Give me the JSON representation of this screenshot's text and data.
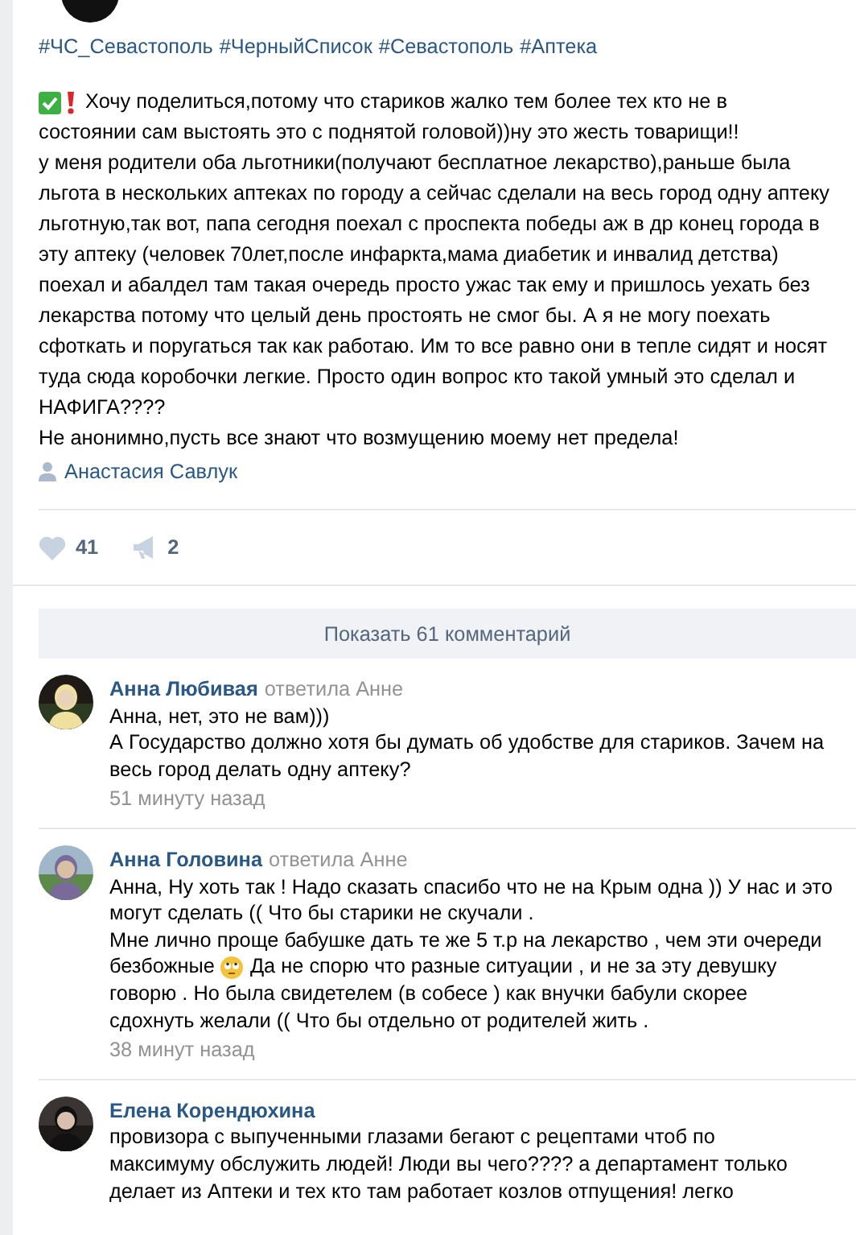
{
  "post": {
    "hashtags": [
      "#ЧС_Севастополь",
      "#ЧерныйСписок",
      "#Севастополь",
      "#Аптека"
    ],
    "lines": [
      "Хочу поделиться,потому что стариков жалко тем более тех кто не в",
      "состоянии сам выстоять это с поднятой головой))ну это жесть товарищи!!",
      "у меня родители оба льготники(получают бесплатное лекарство),раньше была",
      "льгота в нескольких аптеках по городу а сейчас сделали на весь город одну аптеку",
      "льготную,так вот, папа сегодня поехал с проспекта победы аж в др конец города в",
      "эту аптеку (человек 70лет,после инфаркта,мама диабетик и инвалид детства)",
      "поехал и абалдел там такая очередь просто ужас так ему и пришлось уехать без",
      "лекарства потому что целый день простоять не смог бы. А я не могу поехать",
      "сфоткать и поругаться так как работаю. Им то все равно они в тепле сидят и носят",
      "туда сюда коробочки легкие. Просто один вопрос кто такой умный это сделал и",
      "НАФИГА????",
      "Не анонимно,пусть все знают что возмущению моему нет предела!"
    ],
    "author": "Анастасия Савлук",
    "likes": "41",
    "reposts": "2"
  },
  "show_comments": "Показать 61 комментарий",
  "comments": [
    {
      "name": "Анна Любивая",
      "reply_to": "ответила Анне",
      "lines": [
        {
          "kind": "text",
          "text": "Анна, нет, это не вам)))"
        },
        {
          "kind": "text",
          "text": "А Государство должно хотя бы думать об удобстве для стариков. Зачем на"
        },
        {
          "kind": "text",
          "text": "весь город делать одну аптеку?"
        }
      ],
      "time": "51 минуту назад"
    },
    {
      "name": "Анна Головина",
      "reply_to": "ответила Анне",
      "lines": [
        {
          "kind": "text",
          "text": "Анна, Ну хоть так ! Надо сказать спасибо что не на Крым одна )) У нас и это"
        },
        {
          "kind": "text",
          "text": "могут сделать (( Что бы старики не скучали ."
        },
        {
          "kind": "text",
          "text": "Мне лично проще бабушке дать те же 5 т.р на лекарство , чем эти очереди"
        },
        {
          "kind": "emoji",
          "before": "безбожные",
          "after": "Да не спорю что разные ситуации , и не за эту девушку"
        },
        {
          "kind": "text",
          "text": "говорю . Но была свидетелем (в собесе ) как внучки бабули скорее"
        },
        {
          "kind": "text",
          "text": "сдохнуть желали (( Что бы отдельно от родителей жить ."
        }
      ],
      "time": "38 минут назад"
    },
    {
      "name": "Елена Корендюхина",
      "lines": [
        {
          "kind": "text",
          "text": "провизора с выпученными глазами бегают с рецептами чтоб по"
        },
        {
          "kind": "text",
          "text": "максимуму обслужить людей! Люди вы чего???? а департамент только"
        },
        {
          "kind": "text",
          "text": "делает из Аптеки и тех кто там работает козлов отпущения! легко"
        }
      ]
    }
  ]
}
